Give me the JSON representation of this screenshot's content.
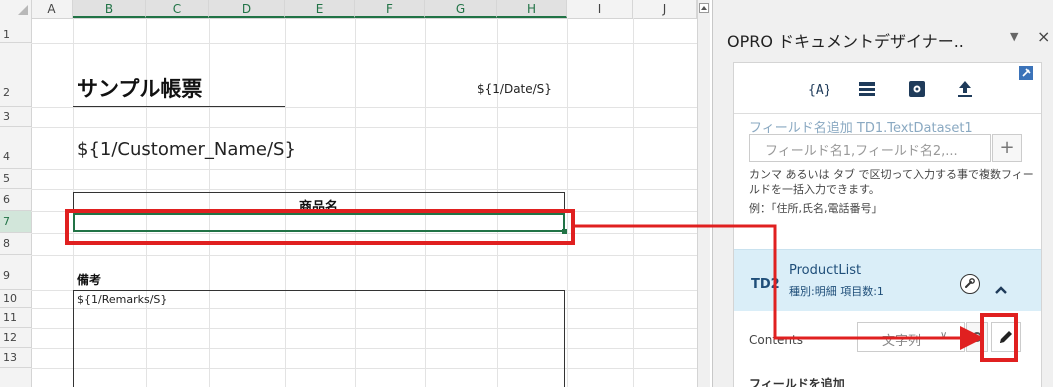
{
  "sheet": {
    "columns": [
      "A",
      "B",
      "C",
      "D",
      "E",
      "F",
      "G",
      "H",
      "I",
      "J"
    ],
    "rows": [
      "1",
      "2",
      "3",
      "4",
      "5",
      "6",
      "7",
      "8",
      "9",
      "10",
      "11",
      "12",
      "13"
    ],
    "cells": {
      "b2_title": "サンプル帳票",
      "h2_date": "${1/Date/S}",
      "b4_customer": "${1/Customer_Name/S}",
      "e6_header": "商品名",
      "b9_remarks_label": "備考",
      "b10_remarks_field": "${1/Remarks/S}"
    }
  },
  "panel": {
    "title": "OPRO ドキュメントデザイナー..",
    "dropdown_glyph": "▼",
    "close_glyph": "×",
    "toolbar": {
      "field_icon_text": "{A}"
    },
    "dataset1_ghost": "フィールド名追加 TD1.TextDataset1",
    "field_input_placeholder": "フィールド名1,フィールド名2,...",
    "add_glyph": "+",
    "help_line": "カンマ あるいは タブ で区切って入力する事で複数フィールドを一括入力できます。",
    "help_example": "例：「住所,氏名,電話番号」",
    "td2": {
      "label": "TD2",
      "name": "ProductList",
      "meta": "種別:明細  項目数:1"
    },
    "contents": {
      "label": "Contents",
      "type_value": "文字列",
      "type_caret": "∨"
    },
    "add_field_header": "フィールドを追加"
  },
  "colors": {
    "excel_green": "#217346",
    "highlight_red": "#e02020",
    "td2_bg": "#daeef8"
  }
}
